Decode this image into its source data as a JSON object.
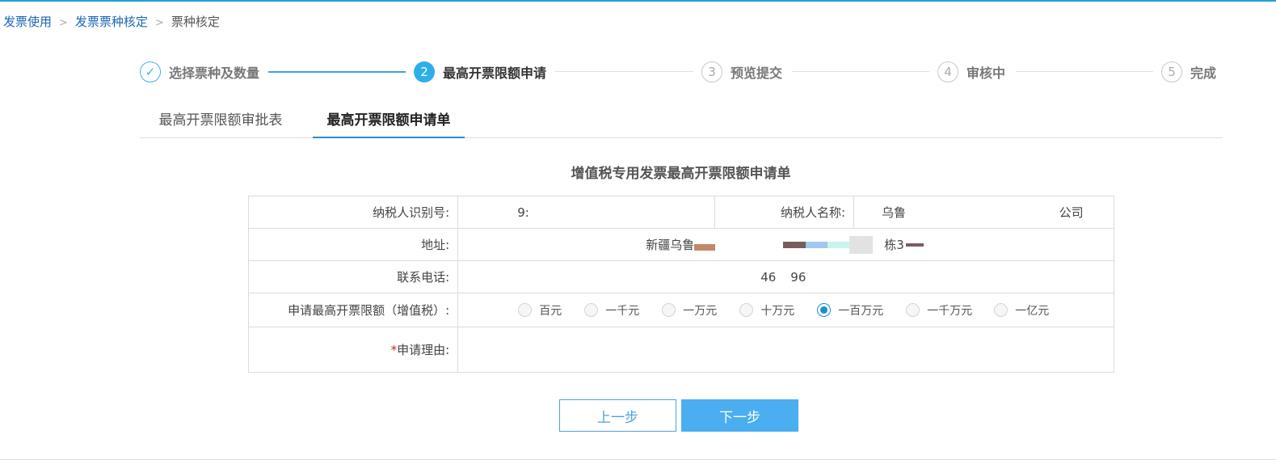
{
  "breadcrumb": {
    "items": [
      "发票使用",
      "发票票种核定"
    ],
    "current": "票种核定",
    "separator": ">"
  },
  "steps": [
    {
      "num": "✓",
      "label": "选择票种及数量",
      "state": "done"
    },
    {
      "num": "2",
      "label": "最高开票限额申请",
      "state": "active"
    },
    {
      "num": "3",
      "label": "预览提交",
      "state": "todo"
    },
    {
      "num": "4",
      "label": "审核中",
      "state": "todo"
    },
    {
      "num": "5",
      "label": "完成",
      "state": "todo"
    }
  ],
  "tabs": [
    {
      "label": "最高开票限额审批表",
      "active": false
    },
    {
      "label": "最高开票限额申请单",
      "active": true
    }
  ],
  "form": {
    "title": "增值税专用发票最高开票限额申请单",
    "taxpayer_id_label": "纳税人识别号:",
    "taxpayer_id_value": "9:",
    "taxpayer_name_label": "纳税人名称:",
    "taxpayer_name_value_start": "乌鲁",
    "taxpayer_name_value_end": "公司",
    "address_label": "地址:",
    "address_value_start": "新疆乌鲁",
    "address_value_end": "栋3",
    "phone_label": "联系电话:",
    "phone_value_start": "46",
    "phone_value_end": "96",
    "limit_label": "申请最高开票限额（增值税）:",
    "limit_options": [
      "百元",
      "一千元",
      "一万元",
      "十万元",
      "一百万元",
      "一千万元",
      "一亿元"
    ],
    "limit_selected": "一百万元",
    "reason_required_mark": "*",
    "reason_label": "申请理由:",
    "reason_value": ""
  },
  "buttons": {
    "prev": "上一步",
    "next": "下一步"
  },
  "colors": {
    "accent": "#2eaee8",
    "link": "#1a66b3",
    "primary_button": "#4aaef0"
  }
}
